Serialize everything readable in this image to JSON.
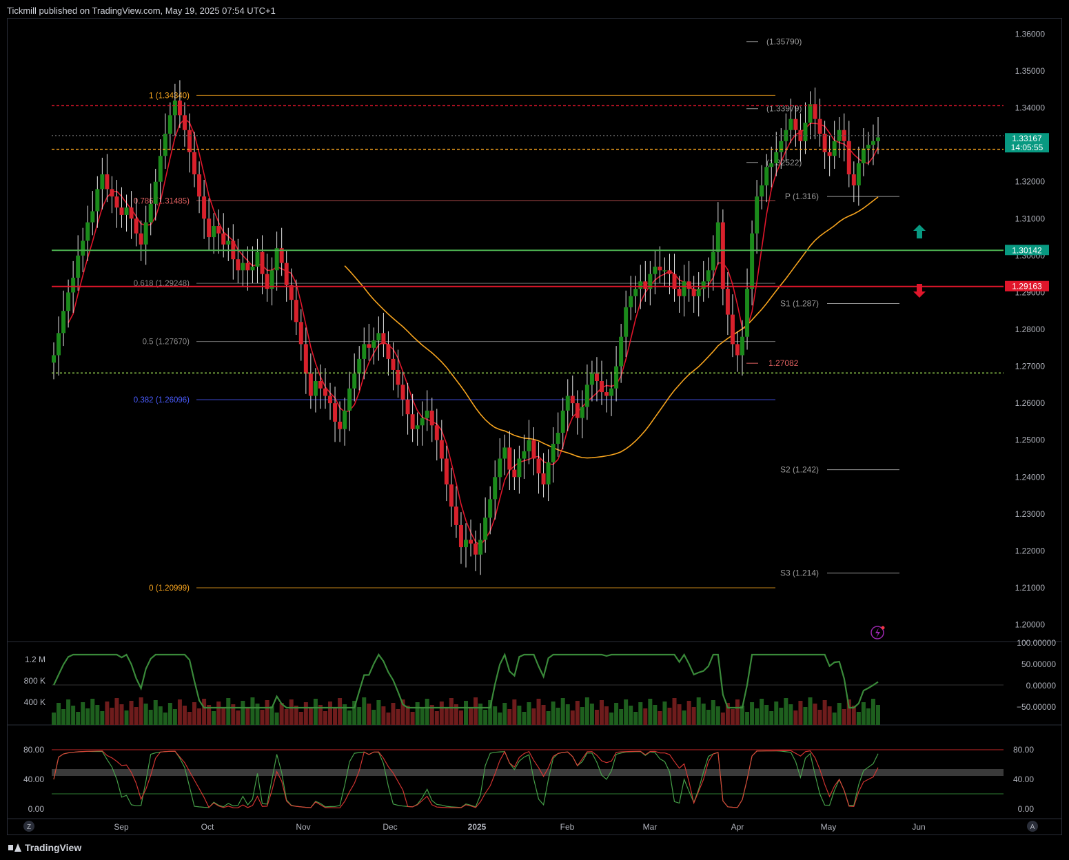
{
  "header": {
    "publisher": "Tickmill published on TradingView.com, May 19, 2025 07:54 UTC+1"
  },
  "footer": {
    "brand": "TradingView"
  },
  "colors": {
    "up": "#1b8a1b",
    "down": "#d8212c",
    "accent": "#f7a41e",
    "bg": "#000000"
  },
  "chart_data": {
    "type": "candlestick",
    "main_axis": {
      "ticks": [
        "1.36000",
        "1.35000",
        "1.34000",
        "1.33000",
        "1.32000",
        "1.31000",
        "1.30000",
        "1.29000",
        "1.28000",
        "1.27000",
        "1.26000",
        "1.25000",
        "1.24000",
        "1.23000",
        "1.22000",
        "1.21000",
        "1.20000"
      ],
      "ylim": [
        1.196,
        1.364
      ]
    },
    "price_badges": [
      {
        "price": 1.33167,
        "label": "1.33167",
        "sub": "14:05:55",
        "color": "#089981"
      },
      {
        "price": 1.30142,
        "label": "1.30142",
        "color": "#089981"
      },
      {
        "price": 1.29163,
        "label": "1.29163",
        "color": "#e0162b"
      }
    ],
    "fib_levels": [
      {
        "price": 1.3434,
        "label": "1 (1.34340)",
        "color": "#f7a41e"
      },
      {
        "price": 1.31485,
        "label": "0.786 (1.31485)",
        "color": "#e06060"
      },
      {
        "price": 1.29248,
        "label": "0.618 (1.29248)",
        "color": "#8a8a8a"
      },
      {
        "price": 1.2767,
        "label": "0.5 (1.27670)",
        "color": "#8a8a8a"
      },
      {
        "price": 1.26096,
        "label": "0.382 (1.26096)",
        "color": "#4a5cff"
      },
      {
        "price": 1.20999,
        "label": "0 (1.20999)",
        "color": "#f7a41e"
      }
    ],
    "pivots": [
      {
        "price": 1.3579,
        "label": "(1.35790)"
      },
      {
        "price": 1.33979,
        "label": "(1.33979)"
      },
      {
        "price": 1.32522,
        "label": "(1.32522)"
      },
      {
        "price": 1.316,
        "label": "P (1.316)"
      },
      {
        "price": 1.287,
        "label": "S1 (1.287)"
      },
      {
        "price": 1.242,
        "label": "S2 (1.242)"
      },
      {
        "price": 1.214,
        "label": "S3 (1.214)"
      },
      {
        "price": 1.27082,
        "label": "1.27082"
      }
    ],
    "x_axis": {
      "labels": [
        "Sep",
        "Oct",
        "Nov",
        "Dec",
        "2025",
        "Feb",
        "Mar",
        "Apr",
        "May",
        "Jun"
      ],
      "corner_left": "Z",
      "corner_right": "A"
    },
    "closes": [
      1.273,
      1.279,
      1.285,
      1.29,
      1.294,
      1.3,
      1.304,
      1.309,
      1.312,
      1.318,
      1.322,
      1.318,
      1.316,
      1.313,
      1.311,
      1.313,
      1.31,
      1.306,
      1.303,
      1.309,
      1.314,
      1.32,
      1.327,
      1.333,
      1.338,
      1.342,
      1.338,
      1.334,
      1.328,
      1.322,
      1.316,
      1.31,
      1.305,
      1.308,
      1.306,
      1.303,
      1.304,
      1.299,
      1.296,
      1.298,
      1.296,
      1.297,
      1.301,
      1.295,
      1.291,
      1.296,
      1.302,
      1.298,
      1.292,
      1.288,
      1.282,
      1.276,
      1.268,
      1.262,
      1.266,
      1.264,
      1.262,
      1.26,
      1.255,
      1.253,
      1.258,
      1.264,
      1.268,
      1.272,
      1.276,
      1.275,
      1.277,
      1.279,
      1.276,
      1.272,
      1.269,
      1.265,
      1.261,
      1.257,
      1.253,
      1.254,
      1.256,
      1.258,
      1.254,
      1.25,
      1.245,
      1.238,
      1.232,
      1.227,
      1.221,
      1.223,
      1.222,
      1.219,
      1.223,
      1.229,
      1.234,
      1.24,
      1.245,
      1.248,
      1.242,
      1.24,
      1.245,
      1.247,
      1.25,
      1.245,
      1.241,
      1.238,
      1.244,
      1.249,
      1.252,
      1.258,
      1.262,
      1.26,
      1.256,
      1.259,
      1.265,
      1.268,
      1.266,
      1.263,
      1.262,
      1.264,
      1.27,
      1.278,
      1.286,
      1.289,
      1.291,
      1.293,
      1.291,
      1.295,
      1.297,
      1.296,
      1.296,
      1.295,
      1.291,
      1.289,
      1.293,
      1.291,
      1.289,
      1.291,
      1.293,
      1.296,
      1.301,
      1.309,
      1.291,
      1.284,
      1.276,
      1.273,
      1.278,
      1.291,
      1.306,
      1.316,
      1.319,
      1.324,
      1.325,
      1.328,
      1.331,
      1.334,
      1.337,
      1.334,
      1.331,
      1.336,
      1.341,
      1.337,
      1.333,
      1.328,
      1.327,
      1.331,
      1.334,
      1.331,
      1.322,
      1.319,
      1.325,
      1.329,
      1.33,
      1.331,
      1.332
    ],
    "volume_axis": [
      "1.2 M",
      "800 K",
      "400 K"
    ],
    "cci_axis": [
      "100.00000",
      "50.00000",
      "0.00000",
      "−50.00000"
    ],
    "stoch_axis_left": [
      "80.00",
      "40.00",
      "0.00"
    ],
    "stoch_axis_right": [
      "80.00",
      "40.00",
      "0.00"
    ]
  }
}
